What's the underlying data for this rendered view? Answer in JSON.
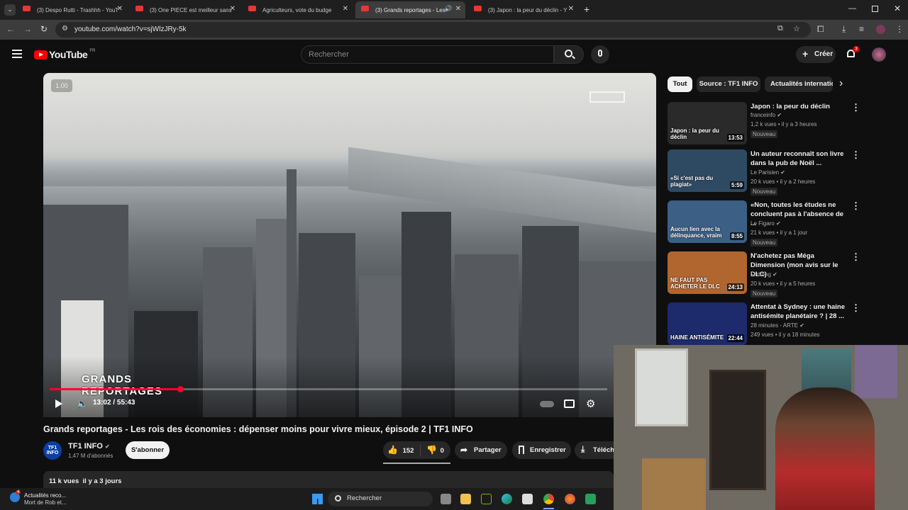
{
  "browser": {
    "tabs": [
      {
        "label": "(3) Despo Rutti - Trashhh - YouT",
        "active": false
      },
      {
        "label": "(3) One PIECE est meilleur sans",
        "active": false
      },
      {
        "label": "Agriculteurs, vote du budge",
        "active": false
      },
      {
        "label": "(3) Grands reportages - Les",
        "active": true
      },
      {
        "label": "(3) Japon : la peur du déclin - Y",
        "active": false
      }
    ],
    "new_tab": "+",
    "url": "youtube.com/watch?v=sjWlzJRy-5k"
  },
  "youtube": {
    "logo_text": "YouTube",
    "region": "FR",
    "search_placeholder": "Rechercher",
    "create_label": "Créer",
    "notifications_count": "3"
  },
  "player": {
    "speed": "1.00",
    "overlay_title": "GRANDS REPORTAGES",
    "current_time": "13:02",
    "duration": "55:43",
    "time_display": "13:02 / 55:43",
    "progress_fraction": 0.234
  },
  "video": {
    "title": "Grands reportages - Les rois des économies : dépenser moins pour vivre mieux, épisode 2 | TF1 INFO",
    "channel": "TF1 INFO",
    "channel_logo": "TF1 INFO",
    "subscribers": "1,47 M d'abonnés",
    "subscribe_label": "S'abonner",
    "likes": "152",
    "dislikes": "0",
    "share_label": "Partager",
    "save_label": "Enregistrer",
    "download_label": "Téléchar",
    "views": "11 k vues",
    "date": "il y a 3 jours"
  },
  "chips": [
    "Tout",
    "Source : TF1 INFO",
    "Actualités internationales"
  ],
  "recommendations": [
    {
      "title": "Japon : la peur du déclin",
      "channel": "franceinfo",
      "views": "1,2 k vues",
      "age": "il y a 3 heures",
      "badge": "Nouveau",
      "duration": "13:53",
      "thumb_text": "Japon : la peur du déclin",
      "thumb_color": "#2a2a2a"
    },
    {
      "title": "Un auteur reconnaît son livre dans la pub de Noël ...",
      "channel": "Le Parisien",
      "views": "20 k vues",
      "age": "il y a 2 heures",
      "badge": "Nouveau",
      "duration": "5:59",
      "thumb_text": "«Si c'est pas du plagiat»",
      "thumb_color": "#2e4a63"
    },
    {
      "title": "«Non, toutes les études ne concluent pas à l'absence de ...",
      "channel": "Le Figaro",
      "views": "21 k vues",
      "age": "il y a 1 jour",
      "badge": "Nouveau",
      "duration": "8:55",
      "thumb_text": "Aucun lien avec la délinquance, vraim",
      "thumb_color": "#3c5f86"
    },
    {
      "title": "N'achetez pas Méga Dimension (mon avis sur le DLC)",
      "channel": "Fildrong",
      "views": "20 k vues",
      "age": "il y a 5 heures",
      "badge": "Nouveau",
      "duration": "24:13",
      "thumb_text": "NE FAUT PAS ACHETER LE DLC",
      "thumb_color": "#b1662f"
    },
    {
      "title": "Attentat à Sydney : une haine antisémite planétaire ? | 28 ...",
      "channel": "28 minutes - ARTE",
      "views": "249 vues",
      "age": "il y a 18 minutes",
      "badge": "",
      "duration": "22:44",
      "thumb_text": "HAINE ANTISÉMITE",
      "thumb_color": "#1d2a6b"
    }
  ],
  "taskbar": {
    "news_title": "Actualités reco...",
    "news_sub": "Mort de Rob et...",
    "news_count": "4",
    "search_label": "Rechercher"
  }
}
